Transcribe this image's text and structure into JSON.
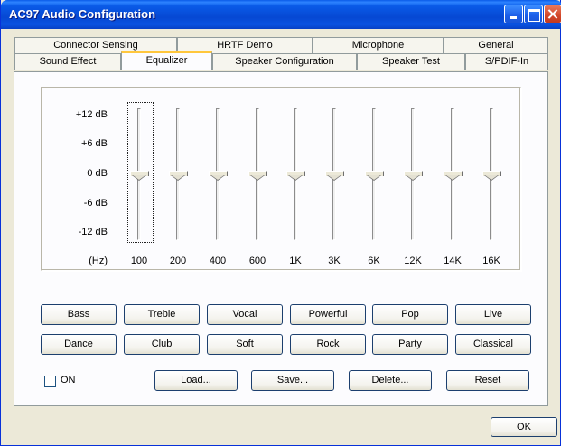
{
  "window": {
    "title": "AC97 Audio Configuration"
  },
  "tabs": {
    "row_back": [
      "Connector Sensing",
      "HRTF Demo",
      "Microphone",
      "General"
    ],
    "row_front": [
      "Sound Effect",
      "Equalizer",
      "Speaker Configuration",
      "Speaker Test",
      "S/PDIF-In"
    ],
    "active": "Equalizer"
  },
  "equalizer": {
    "db_labels": [
      "+12 dB",
      "+6 dB",
      "0 dB",
      "-6 dB",
      "-12 dB"
    ],
    "unit_label": "(Hz)",
    "bands": [
      {
        "freq": "100",
        "gain_db": 0
      },
      {
        "freq": "200",
        "gain_db": 0
      },
      {
        "freq": "400",
        "gain_db": 0
      },
      {
        "freq": "600",
        "gain_db": 0
      },
      {
        "freq": "1K",
        "gain_db": 0
      },
      {
        "freq": "3K",
        "gain_db": 0
      },
      {
        "freq": "6K",
        "gain_db": 0
      },
      {
        "freq": "12K",
        "gain_db": 0
      },
      {
        "freq": "14K",
        "gain_db": 0
      },
      {
        "freq": "16K",
        "gain_db": 0
      }
    ]
  },
  "presets": {
    "row1": [
      "Bass",
      "Treble",
      "Vocal",
      "Powerful",
      "Pop",
      "Live"
    ],
    "row2": [
      "Dance",
      "Club",
      "Soft",
      "Rock",
      "Party",
      "Classical"
    ]
  },
  "controls": {
    "on_label": "ON",
    "on_checked": false,
    "load": "Load...",
    "save": "Save...",
    "delete": "Delete...",
    "reset": "Reset"
  },
  "footer": {
    "ok": "OK"
  }
}
